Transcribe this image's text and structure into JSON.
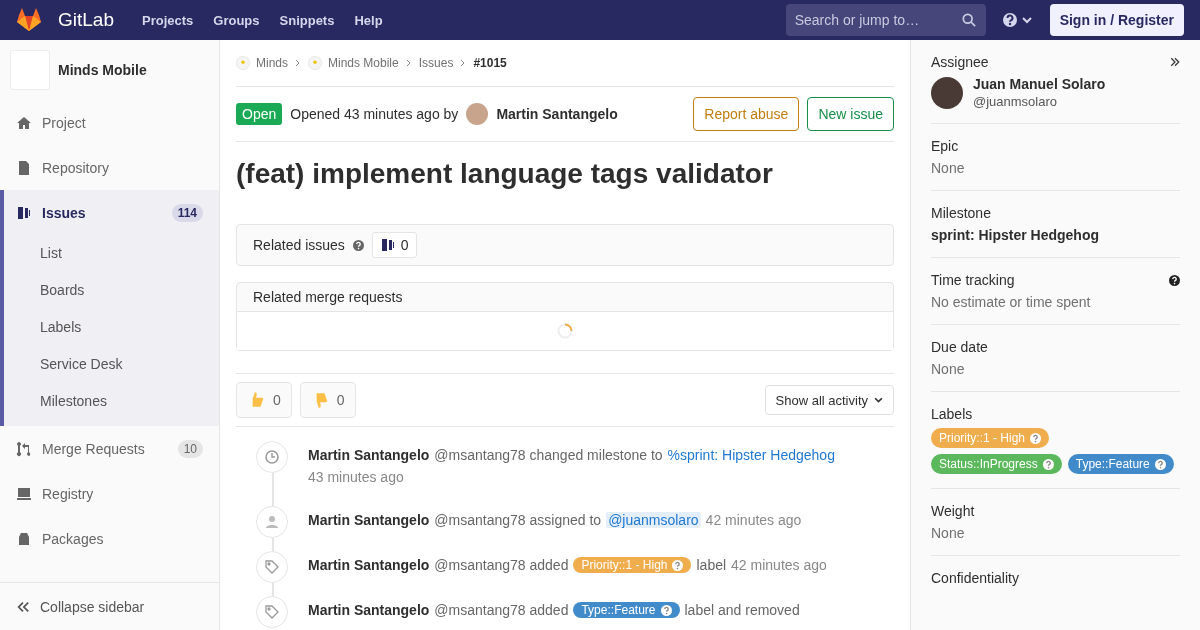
{
  "navbar": {
    "brand": "GitLab",
    "links": [
      "Projects",
      "Groups",
      "Snippets",
      "Help"
    ],
    "search": {
      "placeholder": "Search or jump to…"
    },
    "sign_in": "Sign in / Register"
  },
  "sidebar": {
    "project": "Minds Mobile",
    "items": [
      {
        "label": "Project",
        "kind": "home",
        "selected": false
      },
      {
        "label": "Repository",
        "kind": "doc",
        "selected": false
      },
      {
        "label": "Issues",
        "kind": "issues",
        "selected": true,
        "count": "114",
        "children": [
          {
            "label": "List"
          },
          {
            "label": "Boards"
          },
          {
            "label": "Labels"
          },
          {
            "label": "Service Desk"
          },
          {
            "label": "Milestones"
          }
        ]
      },
      {
        "label": "Merge Requests",
        "kind": "merge",
        "selected": false,
        "count": "10"
      },
      {
        "label": "Registry",
        "kind": "registry",
        "selected": false
      },
      {
        "label": "Packages",
        "kind": "package",
        "selected": false
      }
    ],
    "collapse": "Collapse sidebar"
  },
  "breadcrumbs": [
    {
      "label": "Minds",
      "current": false
    },
    {
      "label": "Minds Mobile",
      "current": false
    },
    {
      "label": "Issues",
      "current": false
    },
    {
      "label": "#1015",
      "current": true
    }
  ],
  "issue": {
    "status": "Open",
    "opened": "Opened 43 minutes ago by",
    "author": "Martin Santangelo",
    "buttons": [
      {
        "label": "Report abuse",
        "kind": "warning"
      },
      {
        "label": "New issue",
        "kind": "success"
      }
    ],
    "title": "(feat) implement language tags validator"
  },
  "related_issues": {
    "label": "Related issues",
    "count": "0"
  },
  "related_merge_requests": {
    "label": "Related merge requests"
  },
  "awards": [
    {
      "kind": "thumbsup",
      "count": "0"
    },
    {
      "kind": "thumbsdown",
      "count": "0"
    }
  ],
  "activity_filter": "Show all activity",
  "activity": [
    {
      "kind": "clock",
      "parts": [
        {
          "kind": "author",
          "text": "Martin Santangelo"
        },
        {
          "kind": "text",
          "text": "@msantang78 changed milestone to"
        },
        {
          "kind": "link",
          "text": "%sprint: Hipster Hedgehog"
        },
        {
          "kind": "time",
          "text": "43 minutes ago"
        }
      ]
    },
    {
      "kind": "user",
      "parts": [
        {
          "kind": "author",
          "text": "Martin Santangelo"
        },
        {
          "kind": "text",
          "text": "@msantang78 assigned to"
        },
        {
          "kind": "mention",
          "text": "@juanmsolaro"
        },
        {
          "kind": "time",
          "text": "42 minutes ago"
        }
      ]
    },
    {
      "kind": "tag",
      "parts": [
        {
          "kind": "author",
          "text": "Martin Santangelo"
        },
        {
          "kind": "text",
          "text": "@msantang78 added"
        },
        {
          "kind": "label",
          "text": "Priority::1 - High",
          "color": "#f0ad4e"
        },
        {
          "kind": "text",
          "text": "label"
        },
        {
          "kind": "time",
          "text": "42 minutes ago"
        }
      ]
    },
    {
      "kind": "tag",
      "parts": [
        {
          "kind": "author",
          "text": "Martin Santangelo"
        },
        {
          "kind": "text",
          "text": "@msantang78 added"
        },
        {
          "kind": "label",
          "text": "Type::Feature",
          "color": "#428bca"
        },
        {
          "kind": "text",
          "text": "label and removed"
        }
      ]
    }
  ],
  "right_sidebar": {
    "assignee": {
      "heading": "Assignee",
      "name": "Juan Manuel Solaro",
      "username": "@juanmsolaro"
    },
    "blocks": [
      {
        "heading": "Epic",
        "value": "None",
        "kind": "muted"
      },
      {
        "heading": "Milestone",
        "value": "sprint: Hipster Hedgehog",
        "kind": "bold"
      },
      {
        "heading": "Time tracking",
        "value": "No estimate or time spent",
        "kind": "muted",
        "help": true
      },
      {
        "heading": "Due date",
        "value": "None",
        "kind": "muted"
      },
      {
        "heading": "Labels",
        "kind": "labels",
        "labels": [
          {
            "text": "Priority::1 - High",
            "color": "#f0ad4e"
          },
          {
            "text": "Status::InProgress",
            "color": "#5cb85c"
          },
          {
            "text": "Type::Feature",
            "color": "#428bca"
          }
        ]
      },
      {
        "heading": "Weight",
        "value": "None",
        "kind": "muted"
      },
      {
        "heading": "Confidentiality",
        "kind": "heading_only"
      }
    ]
  }
}
